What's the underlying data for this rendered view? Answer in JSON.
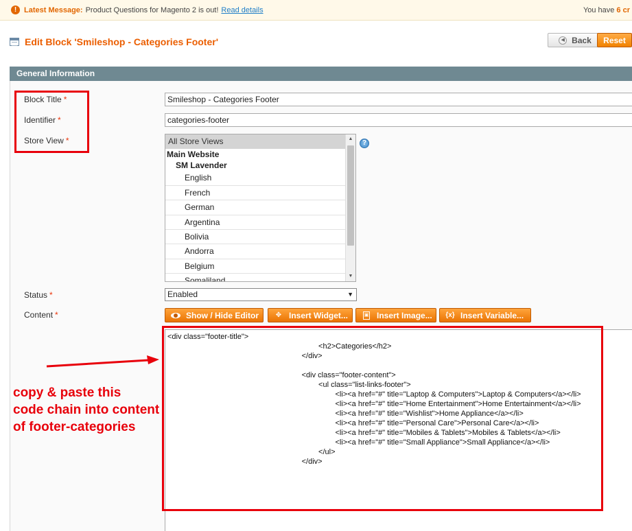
{
  "notice": {
    "label": "Latest Message:",
    "message": "Product Questions for Magento 2 is out!",
    "link": "Read details",
    "right_prefix": "You have",
    "right_count": "6 cr"
  },
  "page": {
    "title": "Edit Block 'Smileshop - Categories Footer'",
    "back_label": "Back",
    "reset_label": "Reset"
  },
  "section": {
    "title": "General Information"
  },
  "form": {
    "block_title": {
      "label": "Block Title",
      "value": "Smileshop - Categories Footer"
    },
    "identifier": {
      "label": "Identifier",
      "value": "categories-footer"
    },
    "store_view": {
      "label": "Store View",
      "options": [
        {
          "text": "All Store Views",
          "kind": "sel"
        },
        {
          "text": "Main Website",
          "kind": "grp grp1"
        },
        {
          "text": "SM Lavender",
          "kind": "grp grp2"
        },
        {
          "text": "English",
          "kind": "child"
        },
        {
          "text": "French",
          "kind": "child"
        },
        {
          "text": "German",
          "kind": "child"
        },
        {
          "text": "Argentina",
          "kind": "child"
        },
        {
          "text": "Bolivia",
          "kind": "child"
        },
        {
          "text": "Andorra",
          "kind": "child"
        },
        {
          "text": "Belgium",
          "kind": "child"
        },
        {
          "text": "Somaliland",
          "kind": "child"
        }
      ]
    },
    "status": {
      "label": "Status",
      "value": "Enabled"
    },
    "content": {
      "label": "Content",
      "buttons": {
        "show_hide": "Show / Hide Editor",
        "insert_widget": "Insert Widget...",
        "insert_image": "Insert Image...",
        "insert_variable": "Insert Variable..."
      },
      "lines": [
        "<div class=\"footer-title\">",
        "\t\t\t\t\t\t\t\t\t<h2>Categories</h2>",
        "\t\t\t\t\t\t\t\t</div>",
        "",
        "\t\t\t\t\t\t\t\t<div class=\"footer-content\">",
        "\t\t\t\t\t\t\t\t\t<ul class=\"list-links-footer\">",
        "\t\t\t\t\t\t\t\t\t\t<li><a href=\"#\" title=\"Laptop & Computers\">Laptop & Computers</a></li>",
        "\t\t\t\t\t\t\t\t\t\t<li><a href=\"#\" title=\"Home Entertainment\">Home Entertainment</a></li>",
        "\t\t\t\t\t\t\t\t\t\t<li><a href=\"#\" title=\"Wishlist\">Home Appliance</a></li>",
        "\t\t\t\t\t\t\t\t\t\t<li><a href=\"#\" title=\"Personal Care\">Personal Care</a></li>",
        "\t\t\t\t\t\t\t\t\t\t<li><a href=\"#\" title=\"Mobiles & Tablets\">Mobiles & Tablets</a></li>",
        "\t\t\t\t\t\t\t\t\t\t<li><a href=\"#\" title=\"Small Appliance\">Small Appliance</a></li>",
        "\t\t\t\t\t\t\t\t\t</ul>",
        "\t\t\t\t\t\t\t\t</div>"
      ]
    }
  },
  "annotation": {
    "line1": "copy & paste this",
    "line2": "code chain into content",
    "line3": "of footer-categories",
    "color": "#e8000b"
  },
  "colors": {
    "accent": "#eb5e00",
    "section_header": "#6f8992",
    "button_orange": "#f18200",
    "required": "#eb340a"
  },
  "icons": {
    "notice": "warning-icon",
    "title": "block-grid-icon",
    "back": "back-arrow-icon",
    "help": "help-icon",
    "eye": "eye-icon",
    "widget": "widget-icon",
    "image": "image-icon",
    "variable": "variable-icon"
  }
}
